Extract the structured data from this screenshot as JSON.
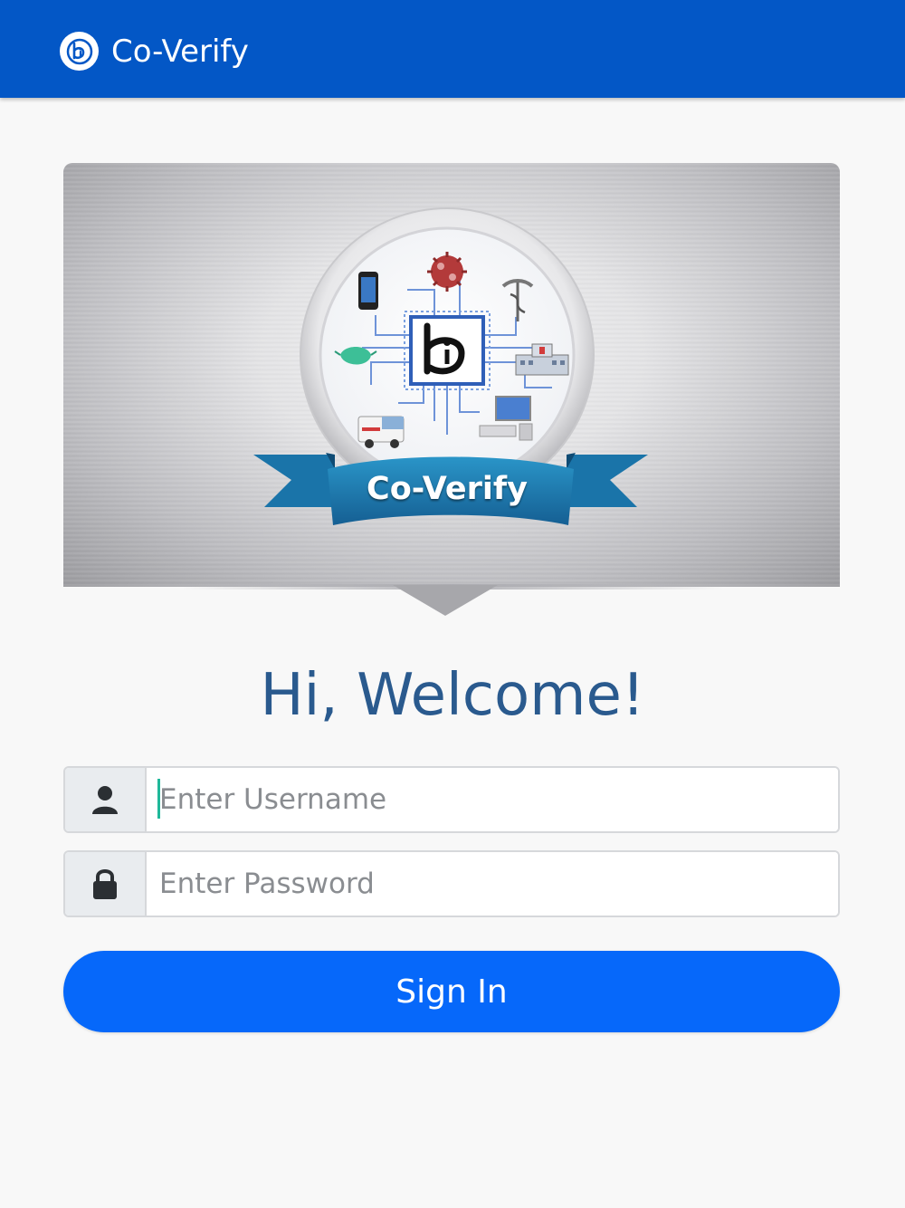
{
  "appbar": {
    "title": "Co-Verify",
    "logo_icon": "bi-logo-icon",
    "background_color": "#0357c6"
  },
  "banner": {
    "badge_label": "Co-Verify",
    "badge_icons": [
      "phone-icon",
      "virus-icon",
      "caduceus-icon",
      "mask-icon",
      "hospital-icon",
      "ambulance-icon",
      "computer-icon",
      "bi-logo-icon"
    ],
    "ribbon_color": "#1d7fb3"
  },
  "welcome": {
    "heading": "Hi, Welcome!",
    "color": "#2a5a8e"
  },
  "form": {
    "username": {
      "placeholder": "Enter Username",
      "value": "",
      "icon": "user-icon"
    },
    "password": {
      "placeholder": "Enter Password",
      "value": "",
      "icon": "lock-icon"
    },
    "signin_label": "Sign In",
    "signin_color": "#0668fa"
  }
}
